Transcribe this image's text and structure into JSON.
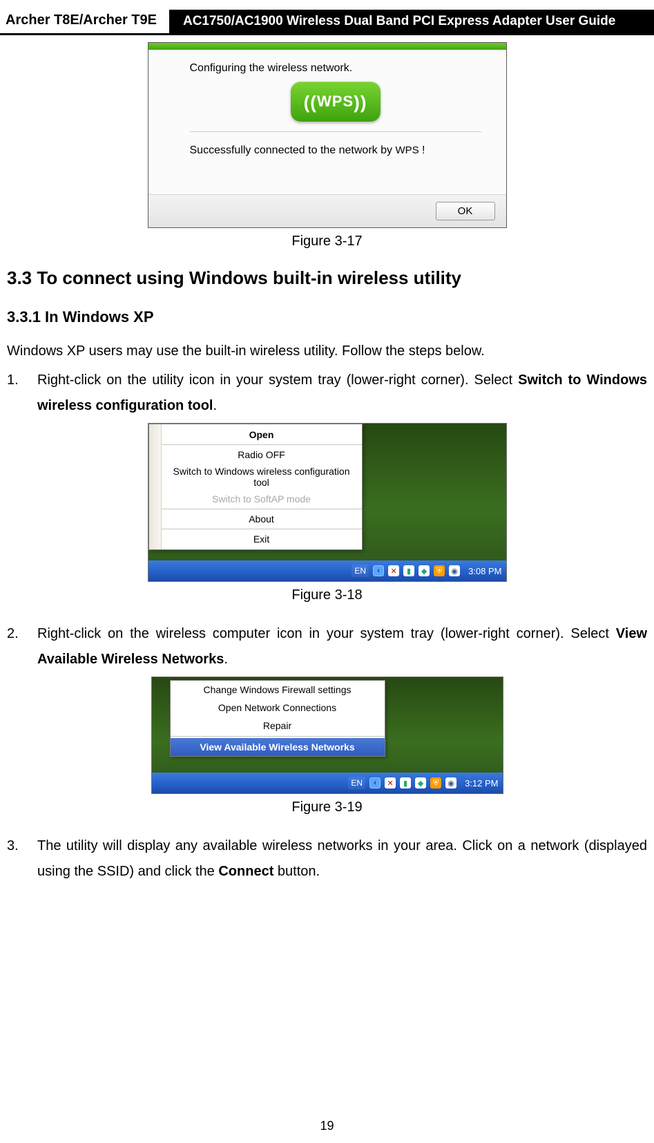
{
  "header": {
    "left": "Archer T8E/Archer T9E",
    "right": "AC1750/AC1900 Wireless Dual Band PCI Express Adapter User Guide"
  },
  "fig17": {
    "configuring": "Configuring the wireless network.",
    "badge": "WPS",
    "success_prefix": "Successfully connected to the network by ",
    "success_abbr": "WPS",
    "success_tail": " !",
    "ok": "OK",
    "caption": "Figure 3-17"
  },
  "section": {
    "num_title": "3.3    To connect using Windows built-in wireless utility",
    "sub_title": "3.3.1   In Windows XP",
    "intro": "Windows XP users may use the built-in wireless utility. Follow the steps below."
  },
  "step1": {
    "num": "1.",
    "text_a": "Right-click on the utility icon in your system tray (lower-right corner). Select ",
    "bold": "Switch to Windows wireless configuration tool",
    "text_b": "."
  },
  "fig18": {
    "items": {
      "open": "Open",
      "radio_off": "Radio OFF",
      "switch": "Switch to Windows wireless configuration tool",
      "softap": "Switch to SoftAP mode",
      "about": "About",
      "exit": "Exit"
    },
    "taskbar": {
      "lang": "EN",
      "time": "3:08 PM"
    },
    "caption": "Figure 3-18"
  },
  "step2": {
    "num": "2.",
    "text_a": "Right-click on the wireless computer icon in your system tray (lower-right corner). Select ",
    "bold": "View Available Wireless Networks",
    "text_b": "."
  },
  "fig19": {
    "items": {
      "firewall": "Change Windows Firewall settings",
      "open_net": "Open Network Connections",
      "repair": "Repair",
      "view": "View Available Wireless Networks"
    },
    "taskbar": {
      "lang": "EN",
      "time": "3:12 PM"
    },
    "caption": "Figure 3-19"
  },
  "step3": {
    "num": "3.",
    "text_a": "The utility will display any available wireless networks in your area. Click on a network (displayed using the SSID) and click the ",
    "bold": "Connect",
    "text_b": " button."
  },
  "page_number": "19"
}
